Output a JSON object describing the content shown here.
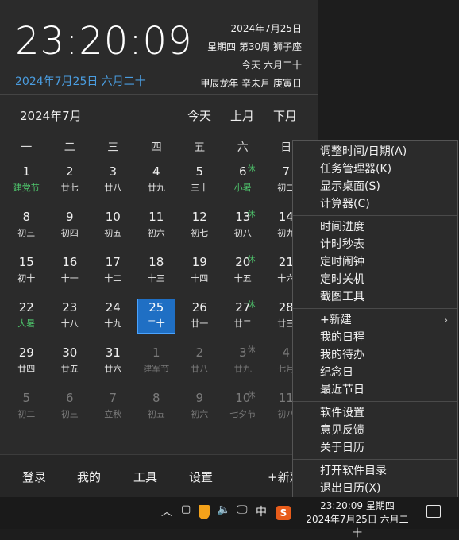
{
  "header": {
    "time": "23:20:09",
    "date": "2024年7月25日 六月二十",
    "info_lines": [
      "2024年7月25日",
      "星期四 第30周 狮子座",
      "今天 六月二十",
      "甲辰龙年 辛未月 庚寅日"
    ]
  },
  "calendar": {
    "month_title": "2024年7月",
    "nav": {
      "today": "今天",
      "prev": "上月",
      "next": "下月"
    },
    "weekdays": [
      "一",
      "二",
      "三",
      "四",
      "五",
      "六",
      "日"
    ],
    "rest_mark": "休",
    "cells": [
      {
        "num": "1",
        "sub": "建党节",
        "holiday": true
      },
      {
        "num": "2",
        "sub": "廿七"
      },
      {
        "num": "3",
        "sub": "廿八"
      },
      {
        "num": "4",
        "sub": "廿九"
      },
      {
        "num": "5",
        "sub": "三十"
      },
      {
        "num": "6",
        "sub": "小暑",
        "holiday": true,
        "rest": true
      },
      {
        "num": "7",
        "sub": "初二"
      },
      {
        "num": "8",
        "sub": "初三"
      },
      {
        "num": "9",
        "sub": "初四"
      },
      {
        "num": "10",
        "sub": "初五"
      },
      {
        "num": "11",
        "sub": "初六"
      },
      {
        "num": "12",
        "sub": "初七"
      },
      {
        "num": "13",
        "sub": "初八",
        "rest": true
      },
      {
        "num": "14",
        "sub": "初九"
      },
      {
        "num": "15",
        "sub": "初十"
      },
      {
        "num": "16",
        "sub": "十一"
      },
      {
        "num": "17",
        "sub": "十二"
      },
      {
        "num": "18",
        "sub": "十三"
      },
      {
        "num": "19",
        "sub": "十四"
      },
      {
        "num": "20",
        "sub": "十五",
        "rest": true
      },
      {
        "num": "21",
        "sub": "十六"
      },
      {
        "num": "22",
        "sub": "大暑",
        "holiday": true
      },
      {
        "num": "23",
        "sub": "十八"
      },
      {
        "num": "24",
        "sub": "十九"
      },
      {
        "num": "25",
        "sub": "二十",
        "today": true
      },
      {
        "num": "26",
        "sub": "廿一"
      },
      {
        "num": "27",
        "sub": "廿二",
        "rest": true
      },
      {
        "num": "28",
        "sub": "廿三"
      },
      {
        "num": "29",
        "sub": "廿四"
      },
      {
        "num": "30",
        "sub": "廿五"
      },
      {
        "num": "31",
        "sub": "廿六"
      },
      {
        "num": "1",
        "sub": "建军节",
        "other": true
      },
      {
        "num": "2",
        "sub": "廿八",
        "other": true
      },
      {
        "num": "3",
        "sub": "廿九",
        "other": true,
        "rest": true
      },
      {
        "num": "4",
        "sub": "七月",
        "other": true
      },
      {
        "num": "5",
        "sub": "初二",
        "other": true
      },
      {
        "num": "6",
        "sub": "初三",
        "other": true
      },
      {
        "num": "7",
        "sub": "立秋",
        "other": true
      },
      {
        "num": "8",
        "sub": "初五",
        "other": true
      },
      {
        "num": "9",
        "sub": "初六",
        "other": true
      },
      {
        "num": "10",
        "sub": "七夕节",
        "other": true,
        "rest": true
      },
      {
        "num": "11",
        "sub": "初八",
        "other": true
      }
    ]
  },
  "bottom_bar": {
    "login": "登录",
    "mine": "我的",
    "tools": "工具",
    "settings": "设置",
    "new": "+新建"
  },
  "context_menu": {
    "groups": [
      [
        "调整时间/日期(A)",
        "任务管理器(K)",
        "显示桌面(S)",
        "计算器(C)"
      ],
      [
        "时间进度",
        "计时秒表",
        "定时闹钟",
        "定时关机",
        "截图工具"
      ],
      [
        "+新建",
        "我的日程",
        "我的待办",
        "纪念日",
        "最近节日"
      ],
      [
        "软件设置",
        "意见反馈",
        "关于日历"
      ],
      [
        "打开软件目录",
        "退出日历(X)"
      ]
    ],
    "submenu_arrow": "›"
  },
  "taskbar": {
    "chevron": "︿",
    "ime": "中",
    "sogou": "S",
    "clock_time": "23:20:09 星期四",
    "clock_date": "2024年7月25日 六月二十"
  },
  "colors": {
    "accent": "#1f6fc4",
    "holiday": "#4ec36b",
    "date_blue": "#4a9de0"
  }
}
